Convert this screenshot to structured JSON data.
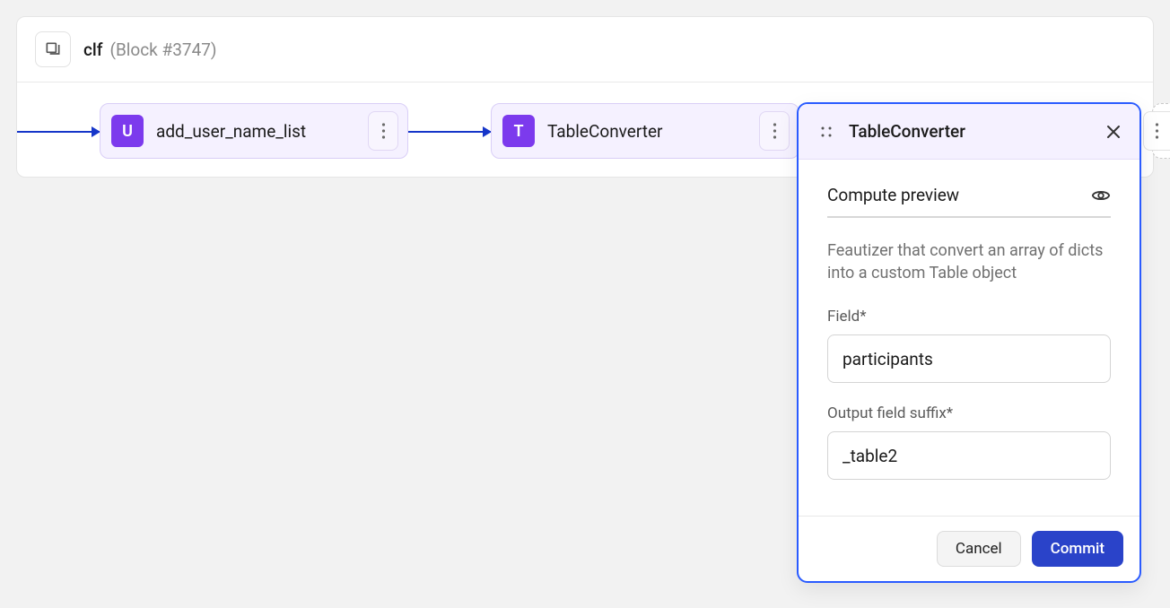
{
  "block": {
    "title": "clf",
    "subtitle": "(Block #3747)"
  },
  "nodes": [
    {
      "initial": "U",
      "label": "add_user_name_list"
    },
    {
      "initial": "T",
      "label": "TableConverter"
    }
  ],
  "panel": {
    "title": "TableConverter",
    "preview_tab": "Compute preview",
    "description": "Feautizer that convert an array of dicts into a custom Table object",
    "fields": {
      "field_label": "Field*",
      "field_value": "participants",
      "suffix_label": "Output field suffix*",
      "suffix_value": "_table2"
    },
    "buttons": {
      "cancel": "Cancel",
      "commit": "Commit"
    }
  }
}
